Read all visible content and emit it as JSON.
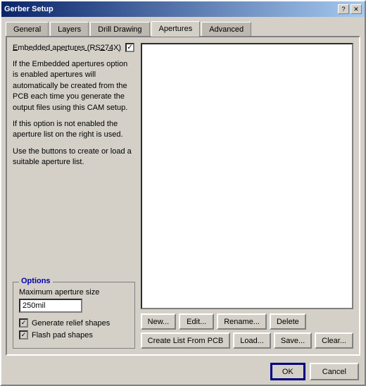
{
  "titleBar": {
    "text": "Gerber Setup",
    "controls": {
      "help": "?",
      "close": "✕"
    }
  },
  "tabs": [
    {
      "id": "general",
      "label": "General",
      "active": false
    },
    {
      "id": "layers",
      "label": "Layers",
      "active": false
    },
    {
      "id": "drill-drawing",
      "label": "Drill Drawing",
      "active": false
    },
    {
      "id": "apertures",
      "label": "Apertures",
      "active": true
    },
    {
      "id": "advanced",
      "label": "Advanced",
      "active": false
    }
  ],
  "content": {
    "embeddedApertures": {
      "label": "Embedded apertures (RS274X)",
      "checked": true
    },
    "description1": "If the Embedded apertures option is enabled apertures will automatically be created from the PCB each time you generate the output files using this CAM setup.",
    "description2": "If this option is not enabled the aperture list on the right is used.",
    "description3": "Use the buttons to create or load a suitable aperture list.",
    "options": {
      "legend": "Options",
      "maxApertureSize": {
        "label": "Maximum aperture size",
        "value": "250mil"
      },
      "generateReliefShapes": {
        "label": "Generate relief shapes",
        "checked": true
      },
      "flashPadShapes": {
        "label": "Flash pad shapes",
        "checked": true
      }
    },
    "buttons": {
      "row1": [
        {
          "id": "new",
          "label": "New..."
        },
        {
          "id": "edit",
          "label": "Edit..."
        },
        {
          "id": "rename",
          "label": "Rename..."
        },
        {
          "id": "delete",
          "label": "Delete"
        }
      ],
      "row2": [
        {
          "id": "create-list",
          "label": "Create List From PCB"
        },
        {
          "id": "load",
          "label": "Load..."
        },
        {
          "id": "save",
          "label": "Save..."
        },
        {
          "id": "clear",
          "label": "Clear..."
        }
      ]
    }
  },
  "bottomButtons": {
    "ok": "OK",
    "cancel": "Cancel"
  }
}
